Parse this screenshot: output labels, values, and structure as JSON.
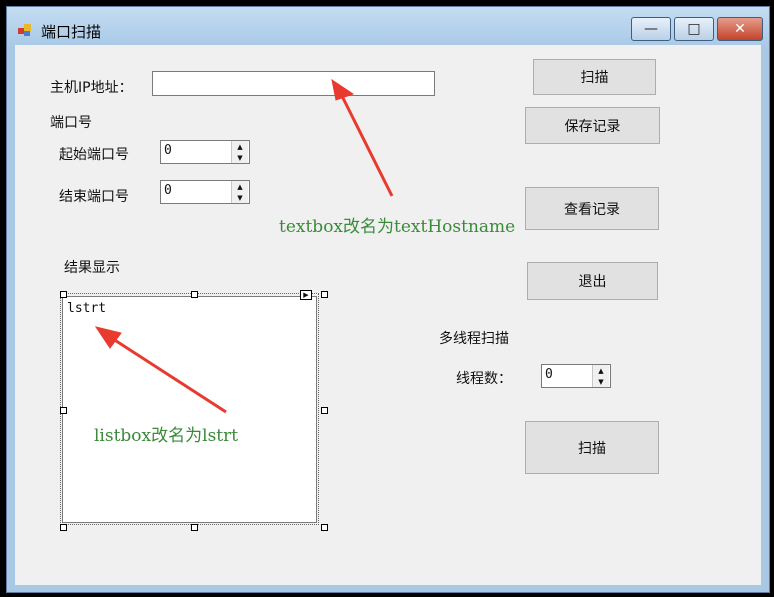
{
  "window": {
    "title": "端口扫描",
    "minimize_label": "—",
    "maximize_label": "□",
    "close_label": "✕"
  },
  "form": {
    "host_label": "主机IP地址：",
    "host_value": "",
    "port_label": "端口号",
    "start_port_label": "起始端口号",
    "start_port_value": "0",
    "end_port_label": "结束端口号",
    "end_port_value": "0",
    "results_label": "结果显示",
    "listbox_item": "lstrt",
    "multithread_label": "多线程扫描",
    "thread_count_label": "线程数：",
    "thread_count_value": "0"
  },
  "buttons": {
    "scan": "扫描",
    "save": "保存记录",
    "view": "查看记录",
    "exit": "退出",
    "scan_multi": "扫描"
  },
  "annotations": {
    "textbox_note": "textbox改名为textHostname",
    "listbox_note": "listbox改名为lstrt",
    "color": "#3a8a3a",
    "arrow_color": "#e83a2e"
  }
}
